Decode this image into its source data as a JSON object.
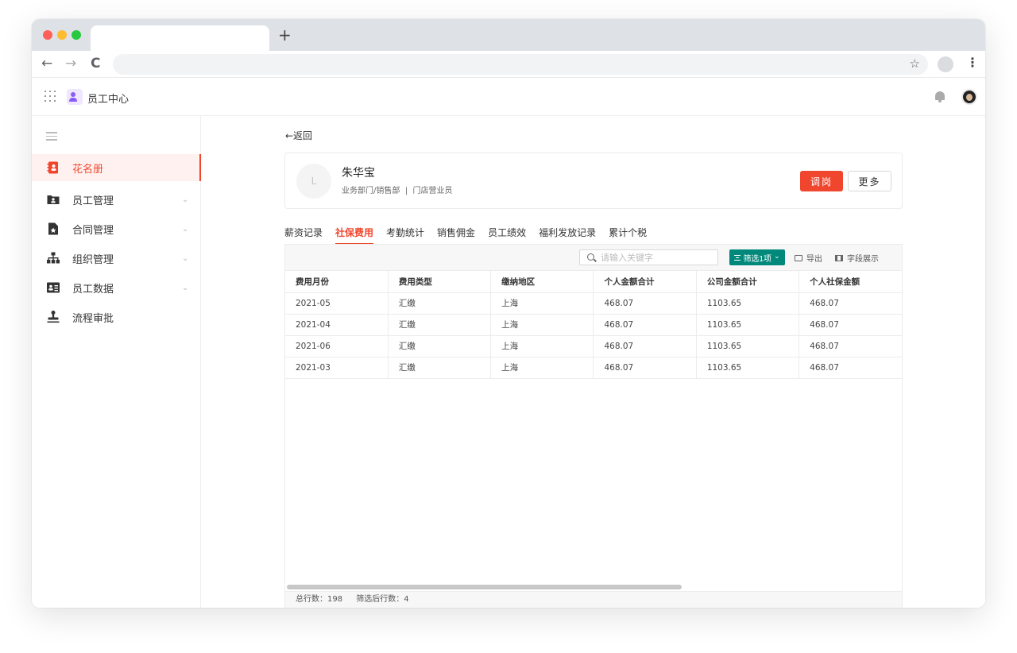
{
  "browser": {
    "new_tab_label": "+",
    "back_glyph": "←",
    "forward_glyph": "→",
    "reload_glyph": "C",
    "star_glyph": "☆",
    "menu_glyph": "⋮"
  },
  "app": {
    "title": "员工中心"
  },
  "sidebar": {
    "items": [
      {
        "label": "花名册",
        "icon": "roster-icon",
        "active": true
      },
      {
        "label": "员工管理",
        "icon": "folder-person-icon",
        "chevron": "⌄"
      },
      {
        "label": "合同管理",
        "icon": "contract-star-icon",
        "chevron": "⌄"
      },
      {
        "label": "组织管理",
        "icon": "org-chart-icon",
        "chevron": "⌄"
      },
      {
        "label": "员工数据",
        "icon": "id-card-icon",
        "chevron": "⌄"
      },
      {
        "label": "流程审批",
        "icon": "stamp-icon"
      }
    ]
  },
  "main": {
    "back_label": "←返回",
    "employee": {
      "avatar_initial": "L",
      "name": "朱华宝",
      "dept": "业务部门/销售部  |  门店营业员"
    },
    "actions": {
      "transfer_label": "调岗",
      "more_label": "更多"
    },
    "tabs": [
      {
        "label": "薪资记录"
      },
      {
        "label": "社保费用",
        "active": true
      },
      {
        "label": "考勤统计"
      },
      {
        "label": "销售佣金"
      },
      {
        "label": "员工绩效"
      },
      {
        "label": "福利发放记录"
      },
      {
        "label": "累计个税"
      }
    ],
    "toolbar": {
      "search_placeholder": "请输入关键字",
      "filter_label": "筛选1项",
      "filter_chevron": "⌄",
      "export_label": "导出",
      "fields_label": "字段展示"
    },
    "table": {
      "columns": [
        "费用月份",
        "费用类型",
        "缴纳地区",
        "个人金额合计",
        "公司金额合计",
        "个人社保金额"
      ],
      "rows": [
        [
          "2021-05",
          "汇缴",
          "上海",
          "468.07",
          "1103.65",
          "468.07"
        ],
        [
          "2021-04",
          "汇缴",
          "上海",
          "468.07",
          "1103.65",
          "468.07"
        ],
        [
          "2021-06",
          "汇缴",
          "上海",
          "468.07",
          "1103.65",
          "468.07"
        ],
        [
          "2021-03",
          "汇缴",
          "上海",
          "468.07",
          "1103.65",
          "468.07"
        ]
      ]
    },
    "footer": {
      "total_rows": "总行数：198",
      "filtered_rows": "筛选后行数：4"
    }
  },
  "colors": {
    "accent": "#f0462d",
    "filter": "#00897b"
  }
}
